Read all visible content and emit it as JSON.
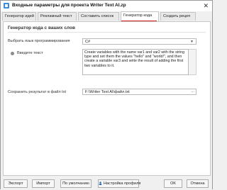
{
  "window": {
    "title": "Входные параметры для проекта Writer Text AI.zp",
    "close_glyph": "✕"
  },
  "tabs": [
    {
      "label": "Генератор идей"
    },
    {
      "label": "Рекламный текст"
    },
    {
      "label": "Составить список"
    },
    {
      "label": "Генератор кода"
    },
    {
      "label": "Создать рецеп"
    }
  ],
  "active_tab": "Генератор кода",
  "form": {
    "heading": "Генератор кода с ваших слов",
    "language_label": "Выбрать язык программирования",
    "language_value": "C#",
    "text_label": "Введите текст",
    "text_value": "Create variables with the name var1 and var2 with the string type and set them the values \"hello\" and \"world!\", and then create a variable var3 and write the result of adding the first two variables to it.",
    "save_label": "Сохранить результат в файл txt",
    "save_value": "F:\\Writer Text AI\\файл.txt",
    "browse_glyph": "..."
  },
  "footer": {
    "export": "Экспорт",
    "import": "Импорт",
    "default": "По умолчанию",
    "profile": "Настройка профиля",
    "ok": "OK",
    "cancel": "Отмена"
  },
  "colors": {
    "active_tab_underline": "#d42020",
    "profile_icon": "#2b6cb0"
  }
}
